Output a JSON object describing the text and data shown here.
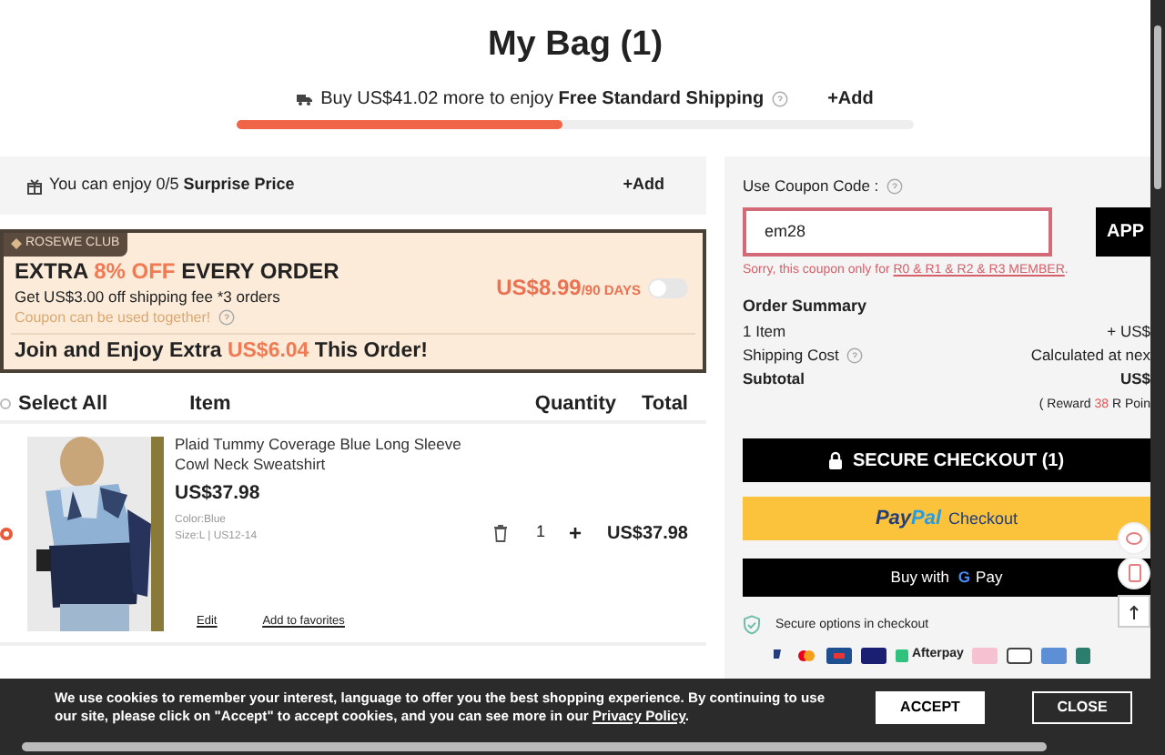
{
  "title": "My Bag (1)",
  "shipping": {
    "text": "Buy US$41.02 more to enjoy **Free Standard Shipping**",
    "add": "+Add",
    "level": 0.48
  },
  "surprise": {
    "text": "You can enjoy 0/5 **Surprise Price**",
    "add": "+Add"
  },
  "club": {
    "badge": "ROSEWE CLUB",
    "headline": [
      {
        "text": "EXTRA ",
        "accent": false
      },
      {
        "text": "8% OFF",
        "accent": true
      },
      {
        "text": " EVERY ORDER",
        "accent": false
      }
    ],
    "subline": "Get US$3.00 off shipping fee *3 orders",
    "note": "Coupon can be used together!",
    "price": "US$8.99",
    "period": "/90 DAYS",
    "on": false,
    "join": [
      {
        "text": "Join and Enjoy Extra ",
        "accent": false
      },
      {
        "text": "US$6.04",
        "accent": true
      },
      {
        "text": " This Order!",
        "accent": false
      }
    ]
  },
  "table": {
    "select_all": {
      "label": "Select All",
      "selected": false
    },
    "columns": [
      "Item",
      "Quantity",
      "Total"
    ]
  },
  "items": [
    {
      "selected": true,
      "name": "Plaid Tummy Coverage Blue Long Sleeve Cowl Neck Sweatshirt",
      "price": "US$37.98",
      "color_label": "Color:Blue",
      "size": "Size:L | US12-14",
      "quantity": "1",
      "plus": "+",
      "total": "US$37.98",
      "edit": "Edit",
      "favorite": "Add to favorites"
    }
  ],
  "coupon": {
    "label": "Use Coupon Code :",
    "value": "em28",
    "apply": "APP",
    "error": "Sorry, this coupon only for ",
    "error_link": "R0 & R1 & R2 & R3 MEMBER",
    "error_end": "."
  },
  "summary": {
    "title": "Order Summary",
    "rows": [
      {
        "label": "1 Item",
        "value": "+ US$",
        "kind": "plain"
      },
      {
        "label": "Shipping Cost",
        "value": "Calculated at nex",
        "kind": "help"
      },
      {
        "label": "Subtotal",
        "value": "US$",
        "kind": "bold"
      }
    ],
    "reward": {
      "before": "( Reward ",
      "points": "38",
      "after": " R Poin"
    }
  },
  "checkout": {
    "secure": "SECURE CHECKOUT (1)",
    "paypal_a": "Pay",
    "paypal_b": "Pal",
    "paypal_c": "Checkout",
    "gpay_prefix": "Buy with",
    "gpay_g": "G",
    "gpay_pay": "Pay"
  },
  "secure_options": "Secure options in checkout",
  "afterpay": "Afterpay",
  "cookie": {
    "text": "We use cookies to remember your interest, language to offer you the best shopping experience. By continuing to use our site, please click on \"Accept\" to accept cookies, and you can see more in our ",
    "link": "Privacy Policy",
    "end": ".",
    "accept": "ACCEPT",
    "close": "CLOSE"
  }
}
